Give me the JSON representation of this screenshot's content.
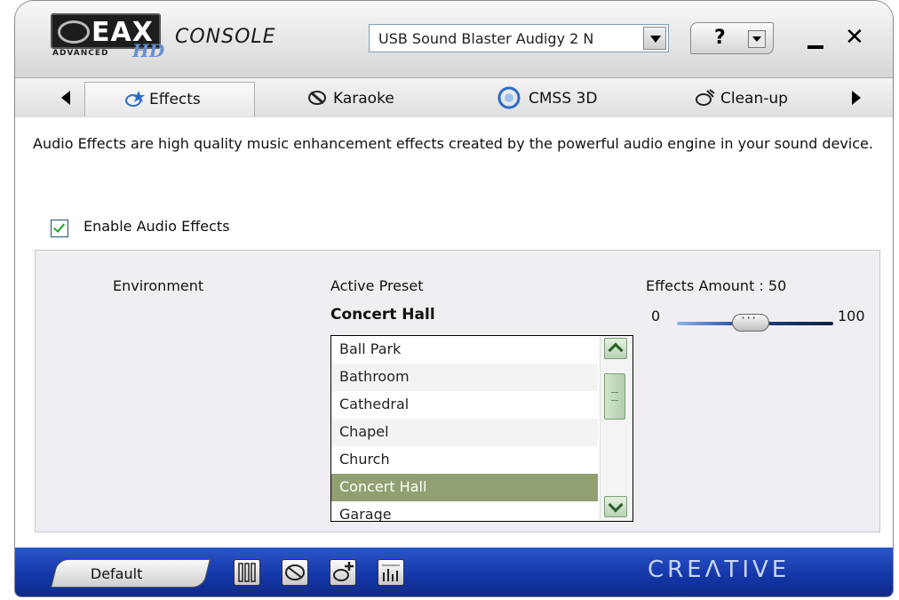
{
  "titlebar": {
    "logo": {
      "brand": "EAX",
      "sub": "ADVANCED",
      "hd": "HD"
    },
    "console_label": "CONSOLE",
    "device_selected": "USB Sound Blaster Audigy 2 N",
    "help_label": "?"
  },
  "tabs": [
    {
      "label": "Effects",
      "icon": "effects-icon",
      "active": true
    },
    {
      "label": "Karaoke",
      "icon": "karaoke-icon",
      "active": false
    },
    {
      "label": "CMSS 3D",
      "icon": "cmss3d-icon",
      "active": false
    },
    {
      "label": "Clean-up",
      "icon": "cleanup-icon",
      "active": false
    }
  ],
  "content": {
    "description": "Audio Effects are high quality music enhancement effects created by the powerful audio engine in your sound device.",
    "enable_label": "Enable Audio Effects",
    "enable_checked": true,
    "environment_label": "Environment",
    "active_preset_label": "Active Preset",
    "active_preset_value": "Concert Hall",
    "presets": [
      "Ball Park",
      "Bathroom",
      "Cathedral",
      "Chapel",
      "Church",
      "Concert Hall",
      "Garage"
    ],
    "selected_preset": "Concert Hall",
    "effects_amount_label": "Effects Amount : 50",
    "effects_amount": 50,
    "slider_min_label": "0",
    "slider_max_label": "100"
  },
  "footer": {
    "default_label": "Default",
    "icons": [
      "mixer-icon",
      "speaker-icon",
      "speaker-add-icon",
      "equalizer-icon"
    ],
    "brand": "CREΛTIVE"
  },
  "colors": {
    "footer_blue": "#1a3fb0",
    "selection_green": "#91a070",
    "panel_lavender": "#f1eef3"
  }
}
